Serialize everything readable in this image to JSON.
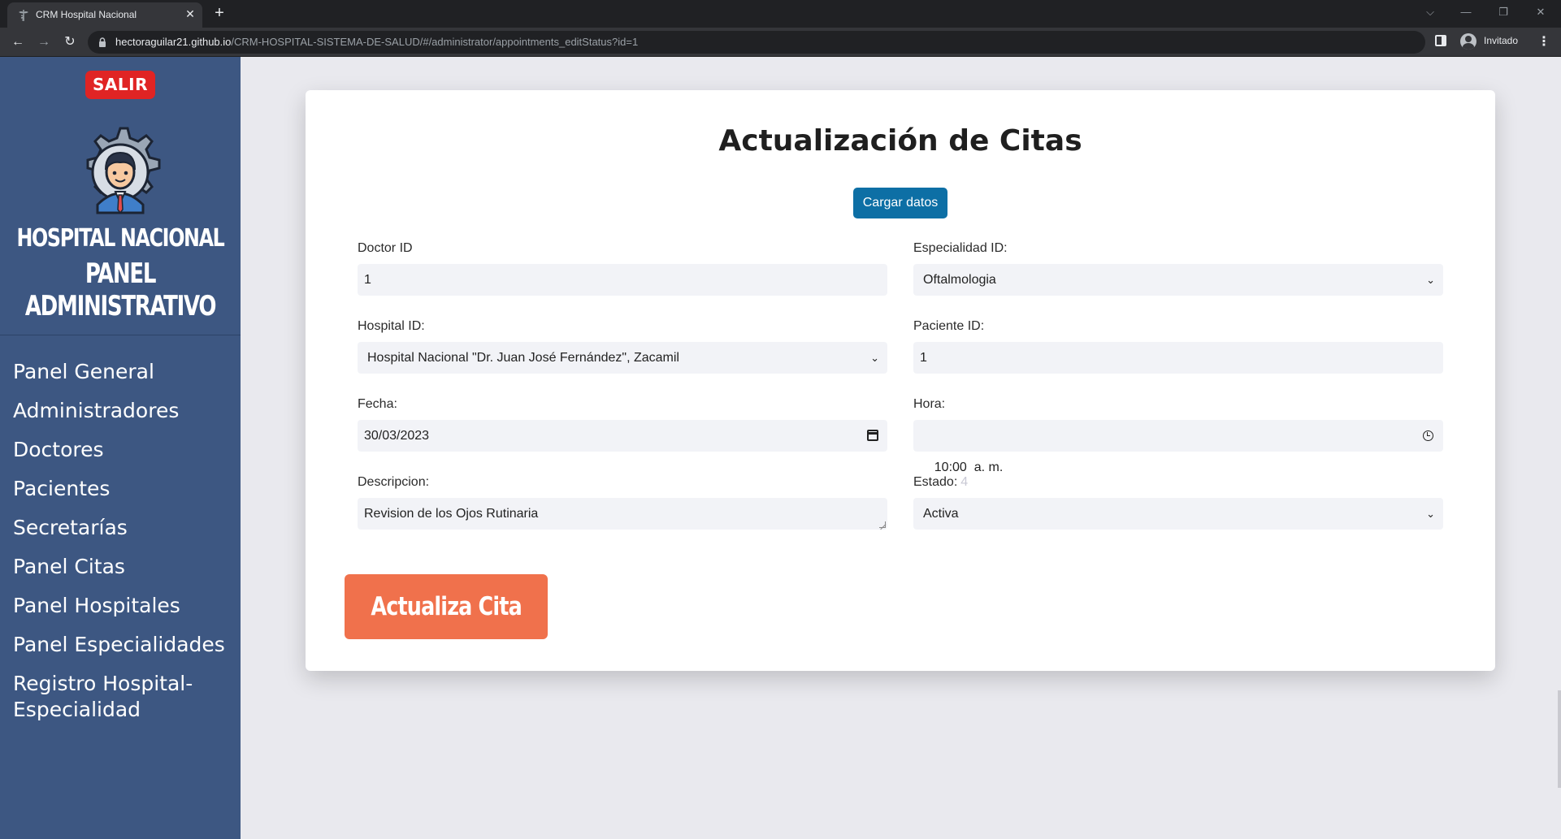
{
  "browser": {
    "tab_title": "CRM Hospital Nacional",
    "tab_close": "✕",
    "new_tab": "+",
    "url_host": "hectoraguilar21.github.io",
    "url_path": "/CRM-HOSPITAL-SISTEMA-DE-SALUD/#/administrator/appointments_editStatus?id=1",
    "profile_label": "Invitado"
  },
  "sidebar": {
    "logout_label": "SALIR",
    "brand_line1": "HOSPITAL NACIONAL",
    "brand_line2": "PANEL",
    "brand_line3": "ADMINISTRATIVO",
    "items": [
      {
        "label": "Panel General"
      },
      {
        "label": "Administradores"
      },
      {
        "label": "Doctores"
      },
      {
        "label": "Pacientes"
      },
      {
        "label": "Secretarías"
      },
      {
        "label": "Panel Citas"
      },
      {
        "label": "Panel Hospitales"
      },
      {
        "label": "Panel Especialidades"
      },
      {
        "label": "Registro Hospital-Especialidad"
      }
    ]
  },
  "form": {
    "title": "Actualización de Citas",
    "load_button": "Cargar datos",
    "doctor_id": {
      "label": "Doctor ID",
      "value": "1"
    },
    "specialty_id": {
      "label": "Especialidad ID:",
      "value": "Oftalmologia"
    },
    "hospital_id": {
      "label": "Hospital ID:",
      "value": "Hospital Nacional \"Dr. Juan José Fernández\", Zacamil"
    },
    "patient_id": {
      "label": "Paciente ID:",
      "value": "1"
    },
    "date": {
      "label": "Fecha:",
      "value": "30/03/2023"
    },
    "time": {
      "label": "Hora:",
      "value": "10:00  a. m."
    },
    "description": {
      "label": "Descripcion:",
      "value": "Revision de los Ojos Rutinaria"
    },
    "status": {
      "label": "Estado:",
      "hint": "4",
      "value": "Activa"
    },
    "submit_button": "Actualiza Cita"
  },
  "colors": {
    "sidebar_bg": "#3d5782",
    "logout_red": "#e02424",
    "primary_blue": "#0d6fa5",
    "submit_orange": "#f0714c"
  }
}
